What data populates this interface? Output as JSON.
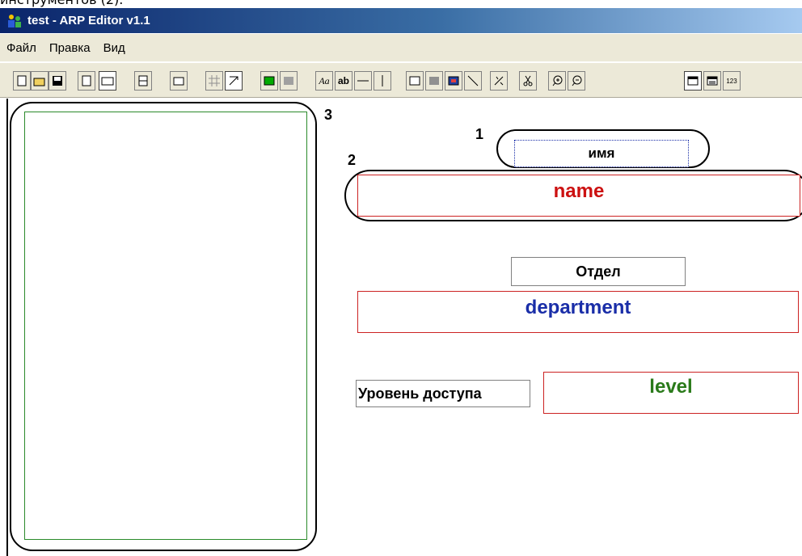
{
  "caption": "инструментов (2).",
  "window": {
    "title": "test - ARP Editor v1.1"
  },
  "menu": [
    "Файл",
    "Правка",
    "Вид"
  ],
  "toolbar_buttons": [
    "new-icon",
    "open-icon",
    "save-icon",
    "page-portrait-icon",
    "page-landscape-icon",
    "page-split-h-icon",
    "page-small-icon",
    "grid-icon",
    "snap-icon",
    "fill-color-icon",
    "border-color-icon",
    "font-icon",
    "text-icon",
    "hline-icon",
    "vline-icon",
    "rect-icon",
    "filled-rect-icon",
    "image-icon",
    "diagonal-line-icon",
    "wand-icon",
    "cut-icon",
    "zoom-in-icon",
    "zoom-out-icon",
    "window-icon",
    "grid-view-icon",
    "numbers-icon"
  ],
  "numbers_label": "123",
  "annotations": {
    "n1": "1",
    "n2": "2",
    "n3": "3"
  },
  "canvas": {
    "name_label": "имя",
    "name_field": "name",
    "dept_label": "Отдел",
    "dept_field": "department",
    "level_label": "Уровень доступа",
    "level_field": "level"
  },
  "colors": {
    "name": "#cc1111",
    "department": "#1a2ea8",
    "level": "#2a7a1a",
    "field_border": "#cc2222"
  }
}
